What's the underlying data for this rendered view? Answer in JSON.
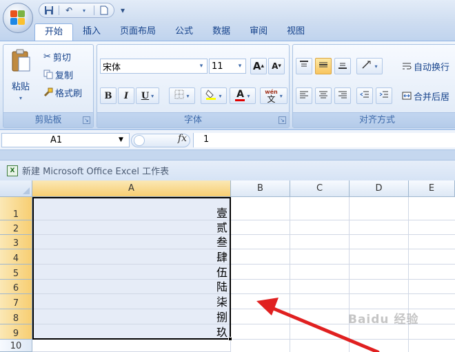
{
  "qat": {
    "save_icon": "save-icon",
    "undo_icon": "undo-icon",
    "new_icon": "new-document-icon",
    "customize": "▾"
  },
  "tabs": [
    "开始",
    "插入",
    "页面布局",
    "公式",
    "数据",
    "审阅",
    "视图"
  ],
  "clipboard": {
    "paste_label": "粘贴",
    "cut_label": "剪切",
    "copy_label": "复制",
    "format_painter_label": "格式刷",
    "group_label": "剪贴板"
  },
  "font": {
    "name": "宋体",
    "size": "11",
    "grow_label": "A",
    "shrink_label": "A",
    "bold": "B",
    "italic": "I",
    "underline": "U",
    "color_letter": "A",
    "phonetic": "wén",
    "phonetic_char": "文",
    "group_label": "字体"
  },
  "alignment": {
    "wrap_label": "自动换行",
    "merge_label": "合并后居",
    "group_label": "对齐方式"
  },
  "formula_bar": {
    "name_box": "A1",
    "fx_label": "fx",
    "value": "1"
  },
  "workbook": {
    "title": "新建 Microsoft Office Excel 工作表",
    "icon_text": "X"
  },
  "columns": [
    "A",
    "B",
    "C",
    "D",
    "E"
  ],
  "rows": [
    "1",
    "2",
    "3",
    "4",
    "5",
    "6",
    "7",
    "8",
    "9",
    "10"
  ],
  "cells_a": [
    "壹",
    "贰",
    "叁",
    "肆",
    "伍",
    "陆",
    "柒",
    "捌",
    "玖",
    ""
  ],
  "watermark": "Baidu 经验",
  "colors": {
    "selection_border": "#000000",
    "arrow": "#e02020",
    "header_selected": "#f7ce72",
    "ribbon": "#dbe7f6"
  }
}
